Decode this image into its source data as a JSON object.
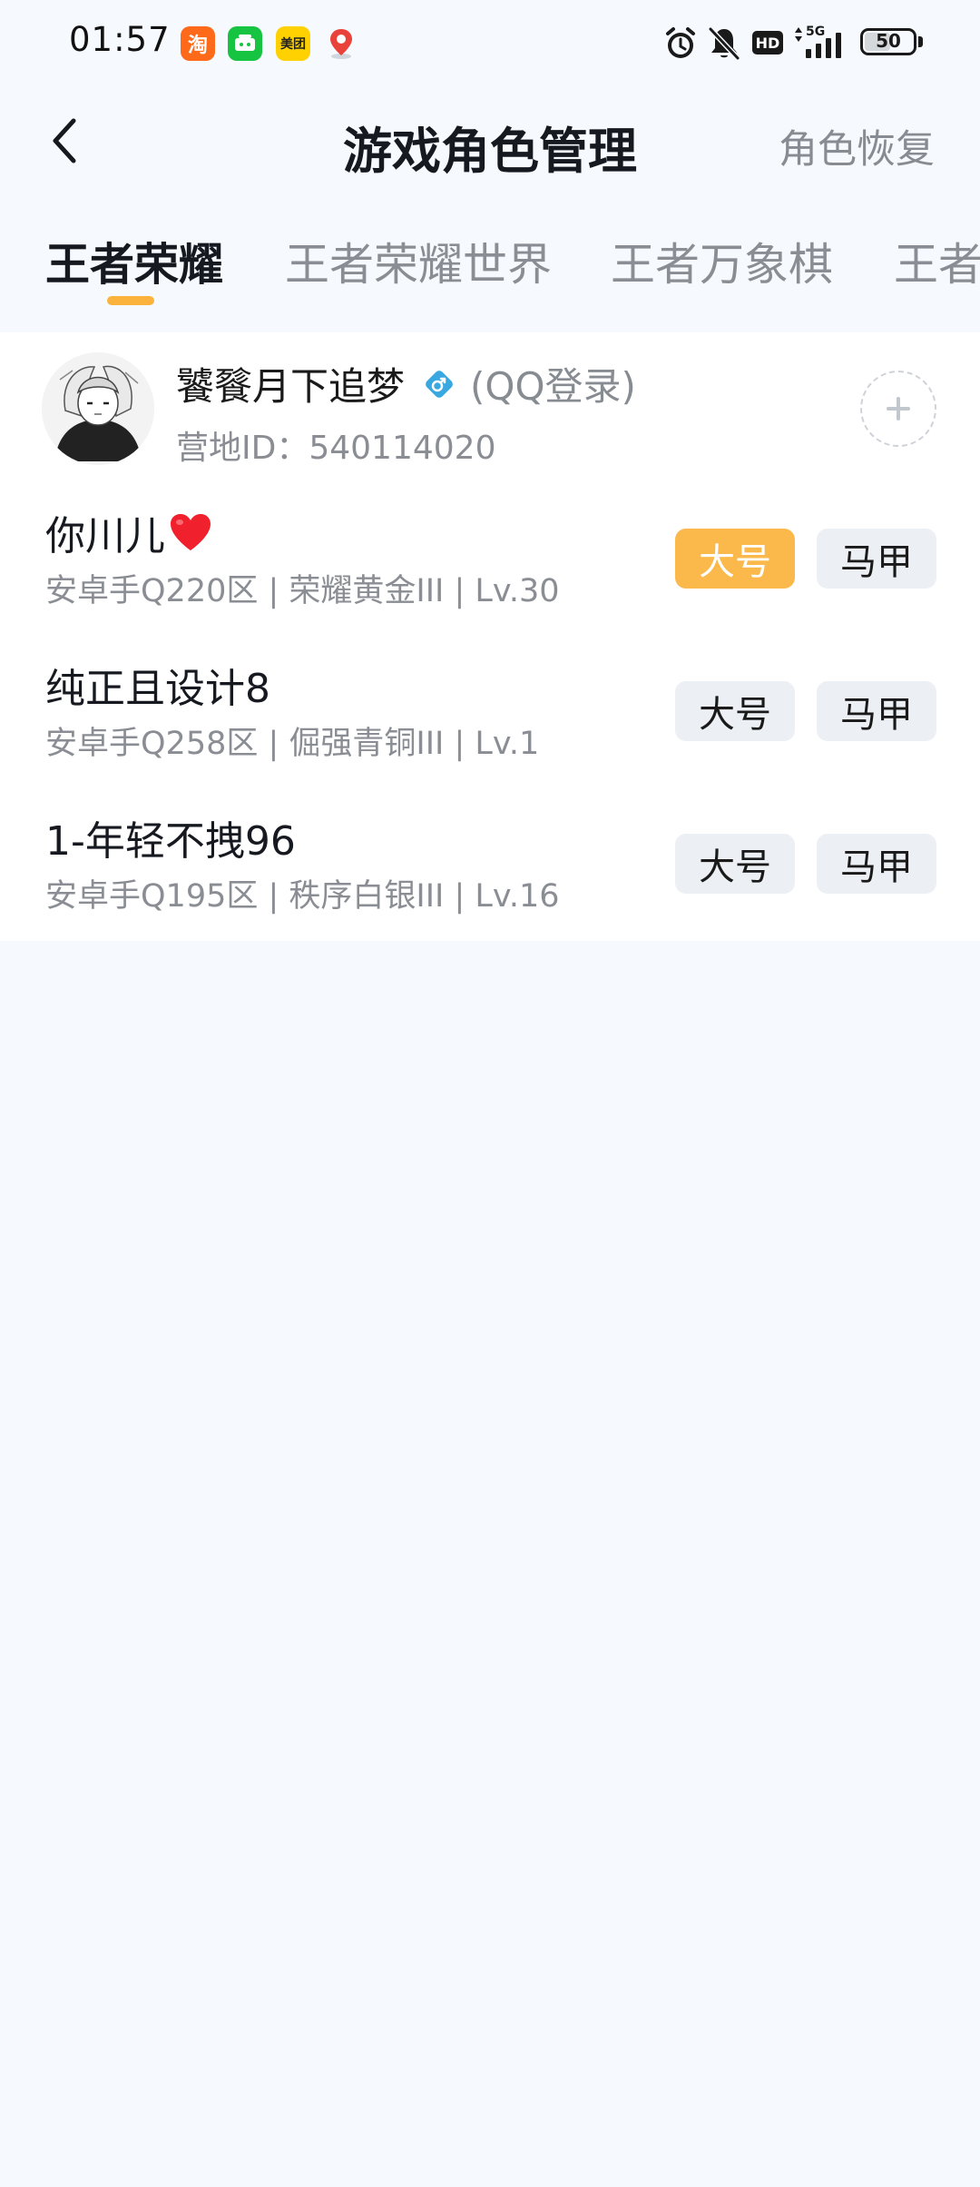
{
  "status_bar": {
    "time": "01:57",
    "apps": [
      {
        "label": "淘",
        "icon": "taobao-icon"
      },
      {
        "label": "",
        "icon": "wechat-icon"
      },
      {
        "label": "美团",
        "icon": "meituan-icon"
      },
      {
        "label": "",
        "icon": "map-pin-icon"
      }
    ],
    "hd_label": "HD",
    "network_label": "5G",
    "battery_level": "50"
  },
  "header": {
    "title": "游戏角色管理",
    "restore_label": "角色恢复"
  },
  "tabs": [
    {
      "label": "王者荣耀",
      "active": true
    },
    {
      "label": "王者荣耀世界",
      "active": false
    },
    {
      "label": "王者万象棋",
      "active": false
    },
    {
      "label": "王者",
      "active": false
    }
  ],
  "profile": {
    "name": "饕餮月下追梦",
    "login_type": "(QQ登录)",
    "camp_id": "营地ID：540114020"
  },
  "roles": [
    {
      "name": "你川儿",
      "has_heart": true,
      "detail": "安卓手Q220区 | 荣耀黄金III | Lv.30",
      "main_label": "大号",
      "alt_label": "马甲",
      "selected": "main"
    },
    {
      "name": "纯正且设计8",
      "has_heart": false,
      "detail": "安卓手Q258区 | 倔强青铜III | Lv.1",
      "main_label": "大号",
      "alt_label": "马甲",
      "selected": "none"
    },
    {
      "name": "1-年轻不拽96",
      "has_heart": false,
      "detail": "安卓手Q195区 | 秩序白银III | Lv.16",
      "main_label": "大号",
      "alt_label": "马甲",
      "selected": "none"
    }
  ],
  "colors": {
    "accent": "#fbb84b",
    "background": "#f6f9fd",
    "gender_male": "#3aa8e0"
  }
}
